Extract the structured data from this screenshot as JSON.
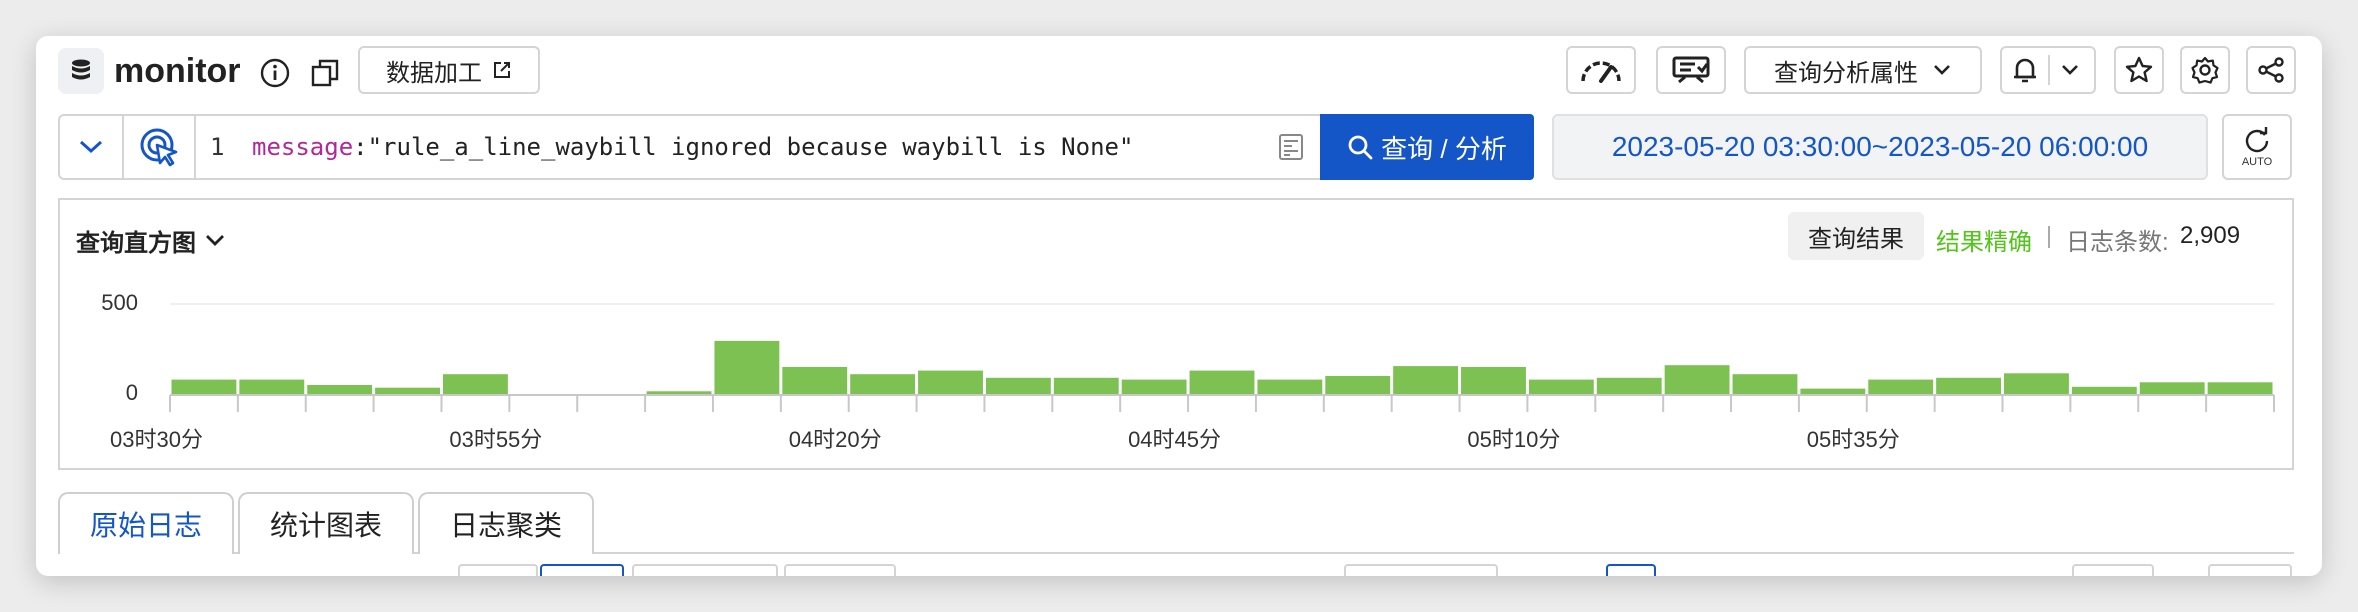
{
  "header": {
    "logstore_name": "monitor",
    "data_process_label": "数据加工",
    "query_attr_label": "查询分析属性"
  },
  "search": {
    "line_number": "1",
    "query_key": "message",
    "query_value": ":\"rule_a_line_waybill ignored because waybill is None\"",
    "submit_label": "查询 / 分析",
    "time_range": "2023-05-20 03:30:00~2023-05-20 06:00:00",
    "auto_label": "AUTO"
  },
  "histogram": {
    "title": "查询直方图",
    "result_button": "查询结果",
    "accuracy": "结果精确",
    "count_label": "日志条数:",
    "count_value": "2,909"
  },
  "tabs": [
    {
      "label": "原始日志",
      "active": true
    },
    {
      "label": "统计图表",
      "active": false
    },
    {
      "label": "日志聚类",
      "active": false
    }
  ],
  "colors": {
    "accent": "#1456c8",
    "bar": "#7cc152",
    "accuracy": "#52c41a",
    "keyword": "#b0289c"
  },
  "chart_data": {
    "type": "bar",
    "y_ticks": [
      "500",
      "0"
    ],
    "ylim": [
      0,
      500
    ],
    "x_tick_labels": [
      "03时30分",
      "03时55分",
      "04时20分",
      "04时45分",
      "05时10分",
      "05时35分"
    ],
    "x_tick_label_bins": [
      0,
      5,
      10,
      15,
      20,
      25
    ],
    "bin_minutes": 5,
    "start": "03:30",
    "values": [
      80,
      80,
      50,
      35,
      110,
      0,
      0,
      15,
      295,
      150,
      110,
      130,
      90,
      90,
      80,
      130,
      80,
      100,
      155,
      150,
      80,
      90,
      160,
      110,
      30,
      80,
      90,
      115,
      40,
      65,
      65
    ]
  }
}
